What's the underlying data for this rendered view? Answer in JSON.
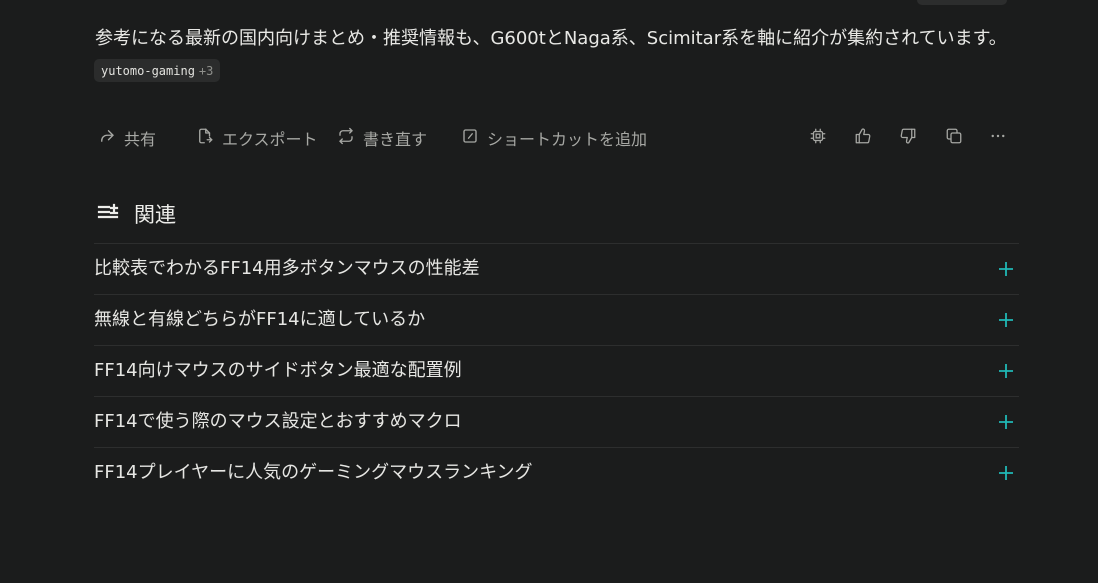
{
  "answer": {
    "paragraph": "参考になる最新の国内向けまとめ・推奨情報も、G600tとNaga系、Scimitar系を軸に紹介が集約されています。",
    "source": {
      "name": "yutomo-gaming",
      "more": "+3"
    }
  },
  "actions": {
    "share_label": "共有",
    "export_label": "エクスポート",
    "rewrite_label": "書き直す",
    "shortcut_label": "ショートカットを追加",
    "icons": [
      "share-icon",
      "export-icon",
      "rewrite-icon",
      "shortcut-icon",
      "chip-icon",
      "thumbs-up-icon",
      "thumbs-down-icon",
      "copy-icon",
      "more-icon"
    ]
  },
  "related": {
    "title": "関連",
    "items": [
      {
        "label": "比較表でわかるFF14用多ボタンマウスの性能差"
      },
      {
        "label": "無線と有線どちらがFF14に適しているか"
      },
      {
        "label": "FF14向けマウスのサイドボタン最適な配置例"
      },
      {
        "label": "FF14で使う際のマウス設定とおすすめマクロ"
      },
      {
        "label": "FF14プレイヤーに人気のゲーミングマウスランキング"
      }
    ]
  },
  "colors": {
    "background": "#1b1c1c",
    "text": "#e6e6e3",
    "muted": "#a7a8a4",
    "accent": "#20b8b5",
    "chip": "#2b2c2c"
  }
}
